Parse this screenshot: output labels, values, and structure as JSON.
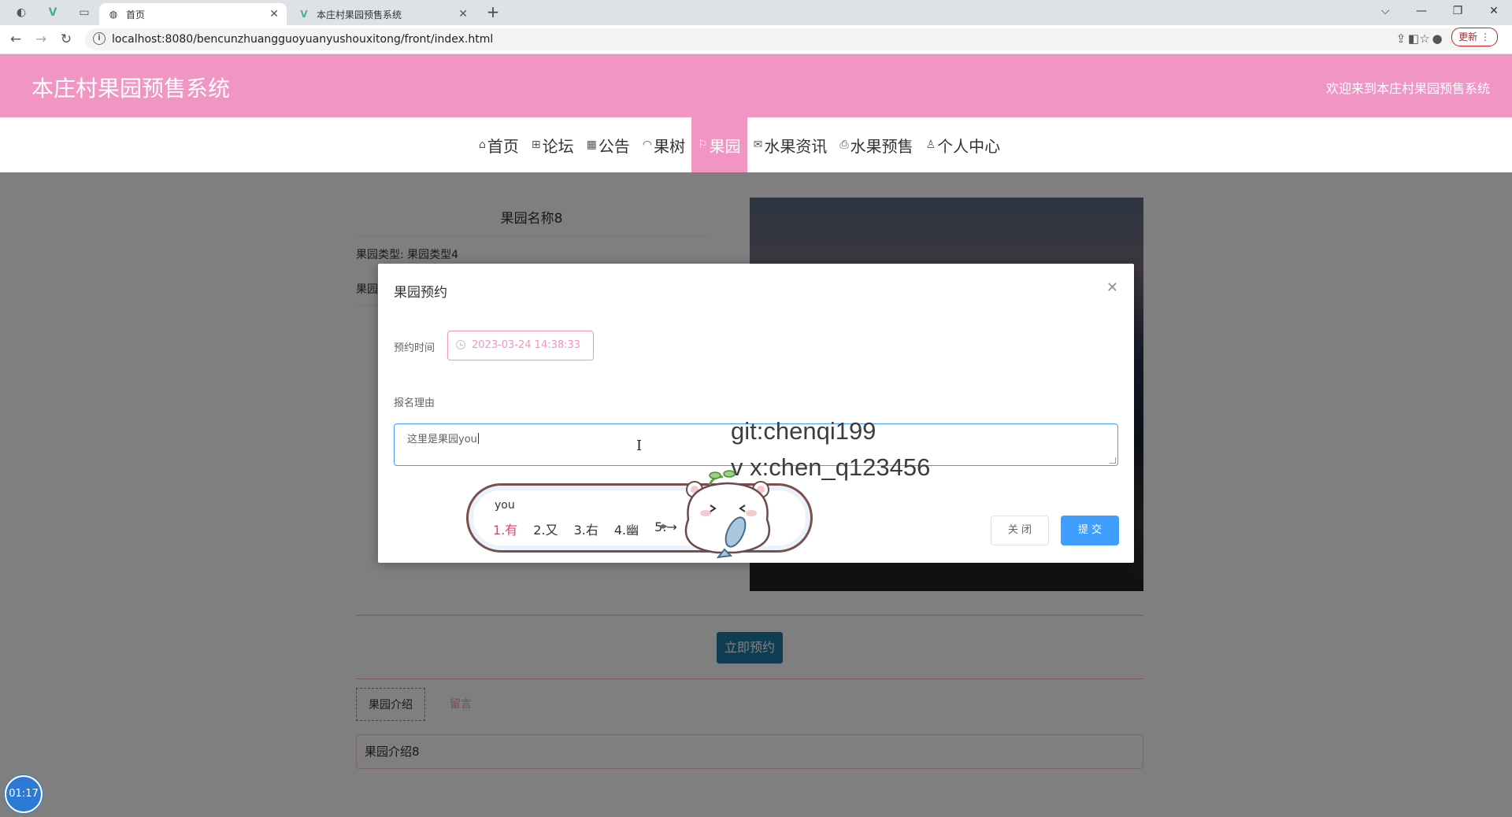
{
  "browser": {
    "tabs": [
      {
        "label": "首页",
        "favicon": "globe-icon"
      },
      {
        "label": "本庄村果园预售系统",
        "favicon": "vue-icon"
      }
    ],
    "url": "localhost:8080/bencunzhuangguoyuanyushouxitong/front/index.html",
    "update_label": "更新"
  },
  "header": {
    "site_title": "本庄村果园预售系统",
    "welcome": "欢迎来到本庄村果园预售系统"
  },
  "nav": {
    "items": [
      {
        "label": "首页",
        "icon": "home-icon"
      },
      {
        "label": "论坛",
        "icon": "forum-icon"
      },
      {
        "label": "公告",
        "icon": "notice-icon"
      },
      {
        "label": "果树",
        "icon": "tree-icon"
      },
      {
        "label": "果园",
        "icon": "flag-icon",
        "active": true
      },
      {
        "label": "水果资讯",
        "icon": "mail-icon"
      },
      {
        "label": "水果预售",
        "icon": "printer-icon"
      },
      {
        "label": "个人中心",
        "icon": "user-icon"
      }
    ]
  },
  "detail": {
    "title": "果园名称8",
    "type_line": "果园类型: 果园类型4",
    "line2": "果园",
    "book_button": "立即预约",
    "tabs": [
      "果园介绍",
      "留言"
    ],
    "intro": "果园介绍8"
  },
  "modal": {
    "title": "果园预约",
    "date_label": "预约时间",
    "date_value": "2023-03-24 14:38:33",
    "reason_label": "报名理由",
    "reason_value": "这里是果园you",
    "close_button": "关 闭",
    "submit_button": "提 交"
  },
  "ime": {
    "composition": "you",
    "candidates": [
      "1.有",
      "2.又",
      "3.右",
      "4.幽",
      "5.→"
    ]
  },
  "watermark": [
    "git:chenqi199",
    "v x:chen_q123456"
  ],
  "timer": "01:17",
  "colors": {
    "brand_pink": "#f095c4",
    "primary_blue": "#409eff"
  }
}
